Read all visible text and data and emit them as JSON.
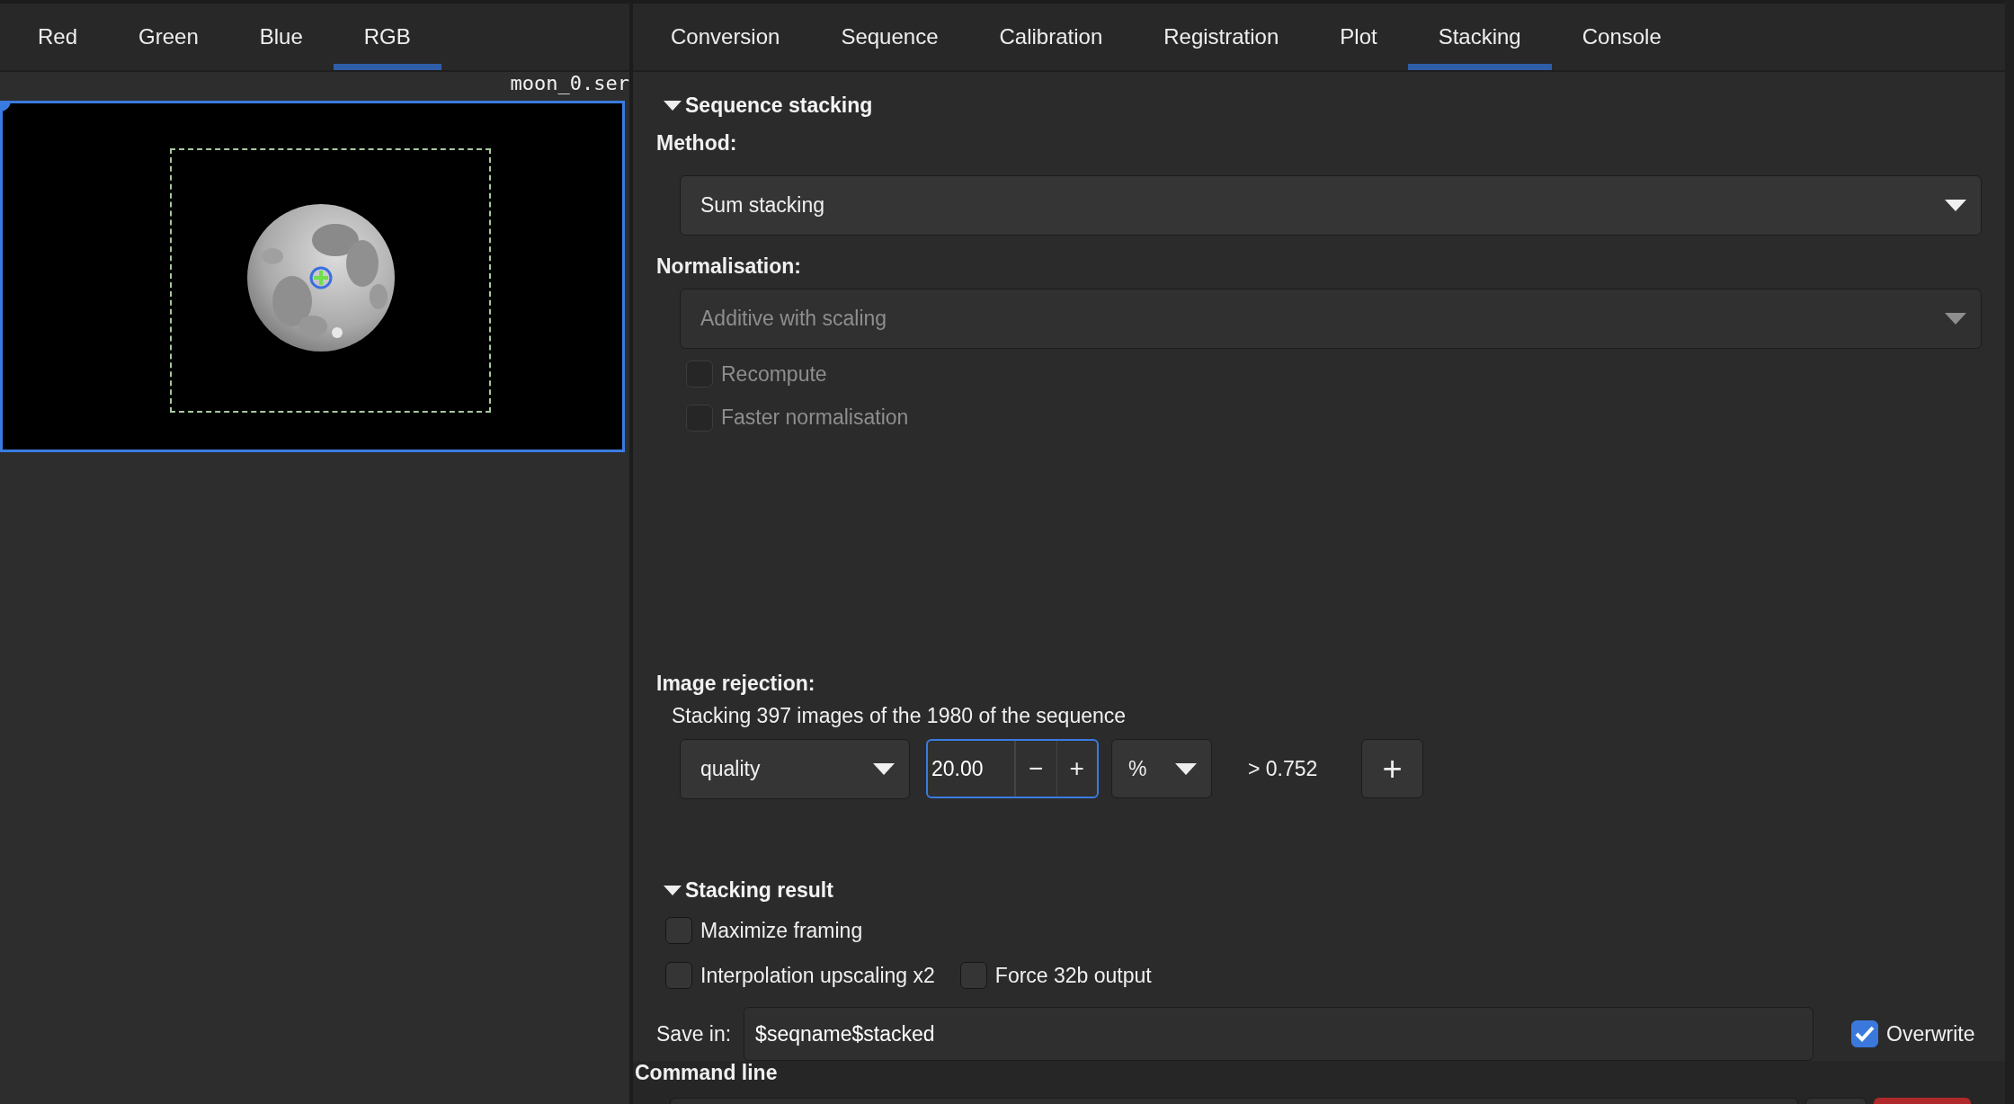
{
  "image_tabs": [
    {
      "label": "Red",
      "selected": false
    },
    {
      "label": "Green",
      "selected": false
    },
    {
      "label": "Blue",
      "selected": false
    },
    {
      "label": "RGB",
      "selected": true
    }
  ],
  "image_panel": {
    "filename": "moon_0.ser"
  },
  "tabs": [
    {
      "label": "Conversion",
      "selected": false
    },
    {
      "label": "Sequence",
      "selected": false
    },
    {
      "label": "Calibration",
      "selected": false
    },
    {
      "label": "Registration",
      "selected": false
    },
    {
      "label": "Plot",
      "selected": false
    },
    {
      "label": "Stacking",
      "selected": true
    },
    {
      "label": "Console",
      "selected": false
    }
  ],
  "sequence_stacking": {
    "title": "Sequence stacking",
    "expanded": true,
    "method_label": "Method:",
    "method": {
      "value": "Sum stacking",
      "disabled": false
    },
    "normalisation_label": "Normalisation:",
    "normalisation": {
      "value": "Additive with scaling",
      "disabled": true
    },
    "options": [
      {
        "label": "Recompute",
        "checked": false,
        "disabled": true
      },
      {
        "label": "Faster normalisation",
        "checked": false,
        "disabled": true
      }
    ],
    "rejection_label": "Image rejection:",
    "rejection_summary": "Stacking 397 images of the 1980 of the sequence",
    "filter": {
      "criterion": "quality",
      "value": "20.00",
      "focused": true,
      "decrement": "−",
      "increment": "+",
      "unit": "%",
      "threshold": "> 0.752",
      "add": "+"
    }
  },
  "stacking_result": {
    "title": "Stacking result",
    "expanded": true,
    "options": [
      {
        "label": "Maximize framing",
        "checked": false
      },
      {
        "label": "Interpolation upscaling x2",
        "checked": false
      },
      {
        "label": "Force 32b output",
        "checked": false
      }
    ],
    "save_label": "Save in:",
    "save_value": "$seqname$stacked",
    "overwrite": {
      "label": "Overwrite",
      "checked": true
    }
  },
  "command_line": {
    "title": "Command line"
  }
}
